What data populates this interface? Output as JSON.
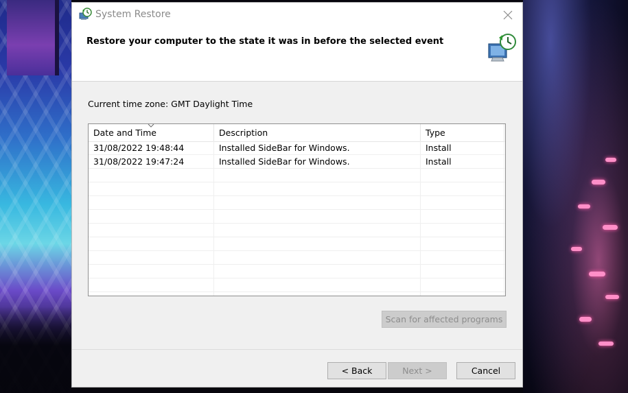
{
  "window": {
    "title": "System Restore",
    "title_icon": "system-restore-icon",
    "close_icon": "close-icon"
  },
  "header": {
    "text": "Restore your computer to the state it was in before the selected event",
    "icon": "computer-restore-icon"
  },
  "timezone_label": "Current time zone: GMT Daylight Time",
  "table": {
    "columns": [
      "Date and Time",
      "Description",
      "Type"
    ],
    "sorted_column": "Date and Time",
    "rows": [
      {
        "date": "31/08/2022 19:48:44",
        "description": "Installed SideBar for Windows.",
        "type": "Install"
      },
      {
        "date": "31/08/2022 19:47:24",
        "description": "Installed SideBar for Windows.",
        "type": "Install"
      }
    ]
  },
  "buttons": {
    "scan": "Scan for affected programs",
    "back": "< Back",
    "next": "Next >",
    "cancel": "Cancel"
  },
  "colors": {
    "dialog_bg": "#f0f0f0",
    "header_bg": "#ffffff",
    "disabled_text": "#8d8d8d"
  }
}
